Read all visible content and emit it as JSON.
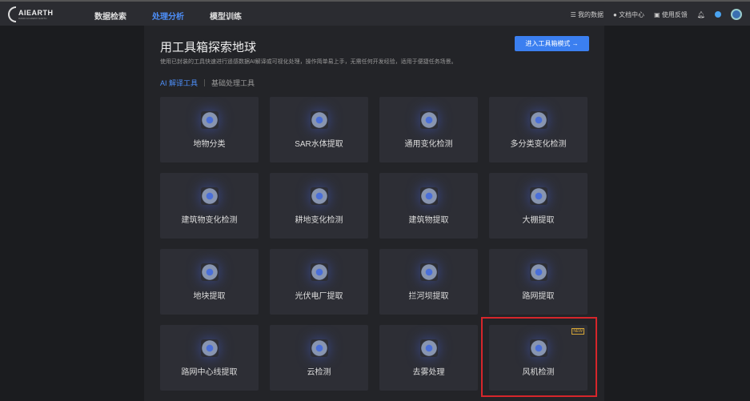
{
  "nav": {
    "logo": "AIEARTH",
    "logo_sub": "DAMO ACADEMY EARTH",
    "menu": [
      "数据检索",
      "处理分析",
      "模型训练"
    ],
    "active": 1,
    "right": [
      "我的数据",
      "文档中心",
      "使用反馈"
    ]
  },
  "header": {
    "title": "用工具箱探索地球",
    "desc": "使用已封装的工具快速进行遥感数据AI解译或可视化处理，操作简单易上手，无需任何开发经验，适用于便捷任务场景。",
    "button": "进入工具箱模式 →"
  },
  "tabs": [
    "AI 解译工具",
    "基础处理工具"
  ],
  "tools": [
    {
      "label": "地物分类",
      "icon": "land-classification-icon"
    },
    {
      "label": "SAR水体提取",
      "icon": "sar-water-icon"
    },
    {
      "label": "通用变化检测",
      "icon": "change-detection-icon"
    },
    {
      "label": "多分类变化检测",
      "icon": "multiclass-change-icon"
    },
    {
      "label": "建筑物变化检测",
      "icon": "building-change-icon"
    },
    {
      "label": "耕地变化检测",
      "icon": "farmland-change-icon"
    },
    {
      "label": "建筑物提取",
      "icon": "building-extract-icon"
    },
    {
      "label": "大棚提取",
      "icon": "greenhouse-icon"
    },
    {
      "label": "地块提取",
      "icon": "parcel-icon"
    },
    {
      "label": "光伏电厂提取",
      "icon": "solar-plant-icon"
    },
    {
      "label": "拦河坝提取",
      "icon": "dam-icon"
    },
    {
      "label": "路网提取",
      "icon": "road-network-icon"
    },
    {
      "label": "路网中心线提取",
      "icon": "road-centerline-icon"
    },
    {
      "label": "云检测",
      "icon": "cloud-icon"
    },
    {
      "label": "去雾处理",
      "icon": "dehaze-icon"
    },
    {
      "label": "风机检测",
      "icon": "wind-turbine-icon",
      "badge": "NEW"
    }
  ]
}
